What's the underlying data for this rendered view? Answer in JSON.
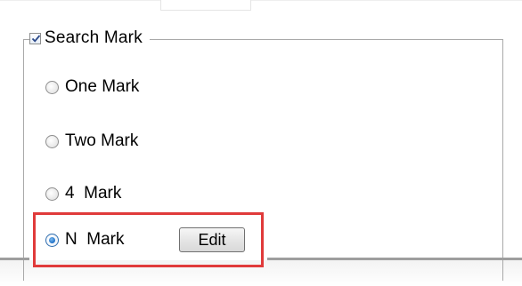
{
  "group": {
    "checkbox_checked": true,
    "title": "Search Mark"
  },
  "options": [
    {
      "label": "One Mark",
      "selected": false
    },
    {
      "label": "Two Mark",
      "selected": false
    },
    {
      "label": "4  Mark",
      "selected": false
    },
    {
      "label": "N  Mark",
      "selected": true
    }
  ],
  "edit_button": {
    "label": "Edit"
  },
  "highlight": {
    "color": "#e03a3a"
  },
  "colors": {
    "radio_selected": "#1d6fc6",
    "border": "#a9a9a9"
  }
}
